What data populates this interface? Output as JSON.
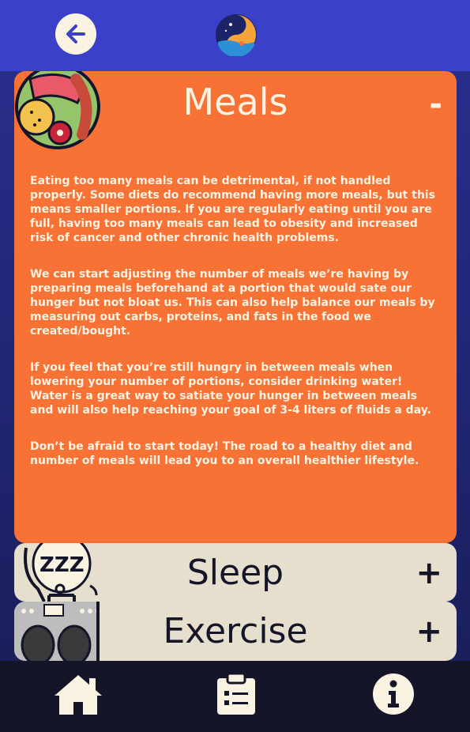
{
  "header": {
    "back_icon": "arrow-left-icon",
    "logo_icon": "yin-yang-sun-logo"
  },
  "cards": {
    "meals": {
      "title": "Meals",
      "toggle": "-",
      "icon": "meal-plate-icon",
      "paragraphs": [
        "Eating too many meals can be detrimental, if not handled properly. Some diets do recommend having more meals, but this means smaller portions. If you are regularly eating until you are full, having too many meals can lead to obesity and increased risk of cancer and other chronic health problems.",
        "We can start adjusting the number of meals we’re having by preparing meals beforehand at a portion that would sate our hunger but not bloat us. This can also help balance our meals by measuring out carbs, proteins, and fats in the food we created/bought.",
        "If you feel that you’re still hungry in between meals when lowering your number of portions, consider drinking water! Water is a great way to satiate your hunger in between meals and will also help reaching your goal of 3-4 liters of fluids a day.",
        "Don’t be afraid to start today! The road to a healthy diet and number of meals will lead you to an overall healthier lifestyle."
      ]
    },
    "sleep": {
      "title": "Sleep",
      "toggle": "+",
      "icon": "sleeping-zzz-icon"
    },
    "exercise": {
      "title": "Exercise",
      "toggle": "+",
      "icon": "exercise-scale-icon"
    }
  },
  "nav": {
    "home_icon": "home-icon",
    "clipboard_icon": "clipboard-icon",
    "info_icon": "info-icon"
  },
  "colors": {
    "header": "#3a40c8",
    "meals_card": "#f87236",
    "collapsed_card": "#e7dfcd",
    "cream": "#fbf3e2",
    "nav_bg": "#141528"
  }
}
